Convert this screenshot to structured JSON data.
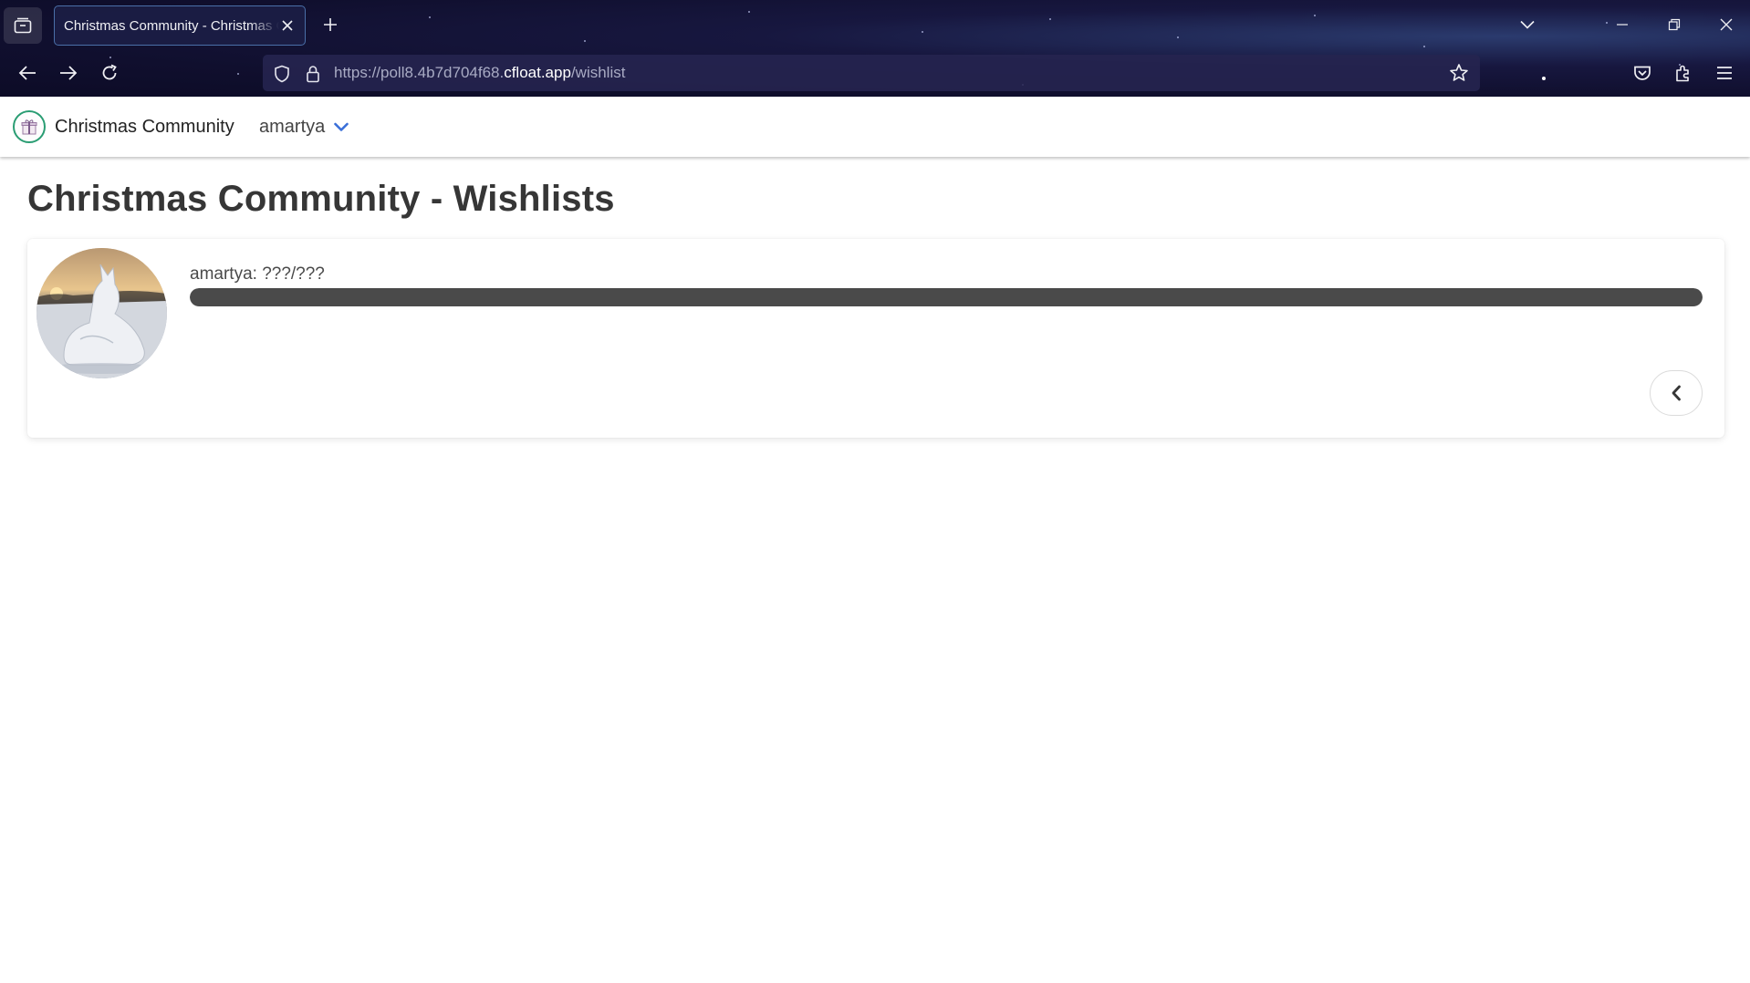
{
  "browser": {
    "tab_title": "Christmas Community - Christmas Community - Wishlists",
    "url_prefix": "https://poll8.4b7d704f68.",
    "url_host": "cfloat.app",
    "url_path": "/wishlist"
  },
  "app": {
    "brand": "Christmas Community",
    "user_menu_label": "amartya"
  },
  "page": {
    "title": "Christmas Community - Wishlists"
  },
  "wishlists": [
    {
      "label": "amartya: ???/???",
      "progress": 1.0
    }
  ],
  "colors": {
    "accent": "#3a6fd8",
    "logo_ring": "#2a9d73",
    "progress_fill": "#4a4a4a",
    "heading": "#363636"
  }
}
